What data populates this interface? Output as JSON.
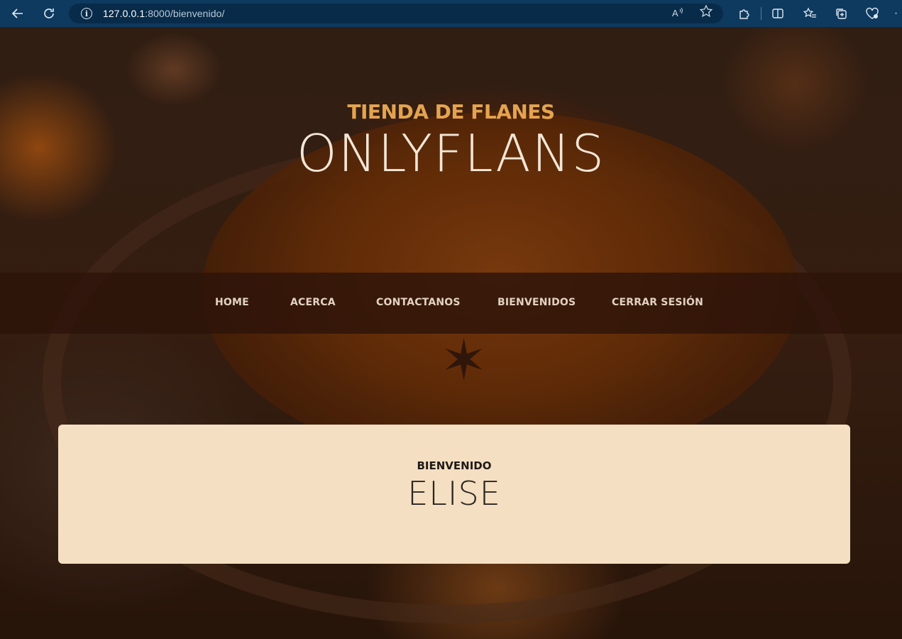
{
  "browser": {
    "url_host": "127.0.0.1",
    "url_path": ":8000/bienvenido/",
    "icons": {
      "back": "back-arrow-icon",
      "reload": "reload-icon",
      "info": "info-icon",
      "read_aloud": "read-aloud-icon",
      "favorite": "star-icon",
      "extensions": "puzzle-icon",
      "split": "split-screen-icon",
      "favorites": "favorites-list-icon",
      "collections": "collections-icon",
      "health": "heart-icon",
      "more": "more-icon"
    }
  },
  "header": {
    "subtitle": "TIENDA DE FLANES",
    "title": "ONLYFLANS"
  },
  "nav": {
    "items": [
      {
        "label": "HOME"
      },
      {
        "label": "ACERCA"
      },
      {
        "label": "CONTACTANOS"
      },
      {
        "label": "BIENVENIDOS"
      },
      {
        "label": "CERRAR SESIÓN"
      }
    ]
  },
  "welcome": {
    "label": "BIENVENIDO",
    "name": "ELISE"
  },
  "colors": {
    "browser_bar": "#0e3a5f",
    "subtitle": "#e5a34f",
    "title": "#f3e6d6",
    "card_bg": "#f5dfc2"
  }
}
